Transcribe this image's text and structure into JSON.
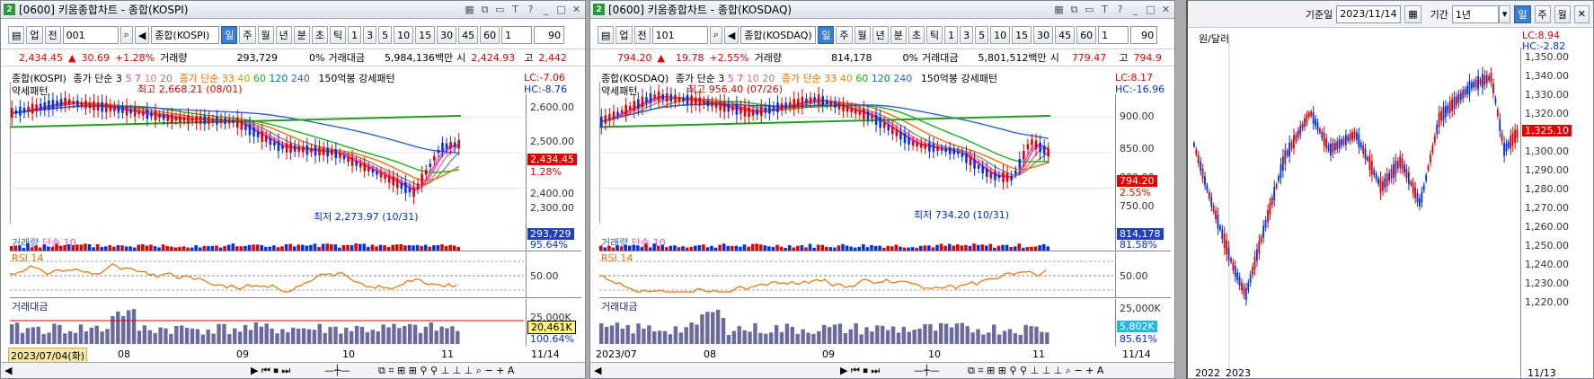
{
  "kospi": {
    "title": {
      "num": "2",
      "text": "[0600] 키움종합차트 - 종합(KOSPI)"
    },
    "toolbar": {
      "mode": "업",
      "period": "전",
      "code": "001",
      "name": "종합(KOSPI)",
      "tabs": [
        "일",
        "주",
        "월",
        "년",
        "분",
        "초",
        "틱"
      ],
      "nums": [
        "1",
        "3",
        "5",
        "10",
        "15",
        "30",
        "45",
        "60"
      ],
      "count1": "1",
      "count2": "90"
    },
    "pricebar": {
      "price": "2,434.45",
      "arrow": "▲",
      "change": "30.69",
      "pct": "+1.28%",
      "vol_label": "거래량",
      "vol": "293,729",
      "vol_pct": "0%",
      "amt_label": "거래대금",
      "amt": "5,984,136백만",
      "open_label": "시",
      "open": "2,424.93",
      "high_label": "고",
      "high": "2,442"
    },
    "legend": {
      "name": "종합(KOSPI)",
      "ma_label": "종가 단순 3",
      "ma_a": [
        "5",
        "7",
        "10",
        "20"
      ],
      "ma_b_label": "종가 단순 33",
      "ma_b": [
        "40",
        "60",
        "120",
        "240"
      ],
      "pattern": "150억봉 강세패턴",
      "pattern2": "약세패턴",
      "lc": "LC:-7.06",
      "hc": "HC:-8.76"
    },
    "ann_high": "최고 2,668.21 (08/01)",
    "ann_low": "최저 2,273.97 (10/31)",
    "price_axis": [
      "2,600.00",
      "2,500.00",
      "2,400.00",
      "2,300.00"
    ],
    "cur_tag": "2,434.45",
    "cur_pct": "1.28%",
    "vol_panel": {
      "label": "거래량",
      "ma": "단순 10",
      "tag": "293,729",
      "pct": "95.64%"
    },
    "rsi_panel": {
      "label": "RSI 14",
      "level": "50.00"
    },
    "amt_panel": {
      "label": "거래대금",
      "level": "25,000K",
      "tag": "20,461K",
      "pct": "100.64%"
    },
    "dates": {
      "start": "2023/07/04(화)",
      "m1": "08",
      "m2": "09",
      "m3": "10",
      "m4": "11",
      "end": "11/14"
    }
  },
  "kosdaq": {
    "title": {
      "num": "2",
      "text": "[0600] 키움종합차트 - 종합(KOSDAQ)"
    },
    "toolbar": {
      "mode": "업",
      "period": "전",
      "code": "101",
      "name": "종합(KOSDAQ)",
      "tabs": [
        "일",
        "주",
        "월",
        "년",
        "분",
        "초",
        "틱"
      ],
      "nums": [
        "1",
        "3",
        "5",
        "10",
        "15",
        "30",
        "45",
        "60"
      ],
      "count1": "1",
      "count2": "90"
    },
    "pricebar": {
      "price": "794.20",
      "arrow": "▲",
      "change": "19.78",
      "pct": "+2.55%",
      "vol_label": "거래량",
      "vol": "814,178",
      "vol_pct": "0%",
      "amt_label": "거래대금",
      "amt": "5,801,512백만",
      "open_label": "시",
      "open": "779.47",
      "high_label": "고",
      "high": "794.9"
    },
    "legend": {
      "name": "종합(KOSDAQ)",
      "ma_label": "종가 단순 3",
      "ma_a": [
        "5",
        "7",
        "10",
        "20"
      ],
      "ma_b_label": "종가 단순 33",
      "ma_b": [
        "40",
        "60",
        "120",
        "240"
      ],
      "pattern": "150억봉 강세패턴",
      "pattern2": "약세패턴",
      "lc": "LC:8.17",
      "hc": "HC:-16.96"
    },
    "ann_high": "최고 956.40 (07/26)",
    "ann_low": "최저 734.20 (10/31)",
    "price_axis": [
      "900.00",
      "850.00",
      "800.00",
      "750.00"
    ],
    "cur_tag": "794.20",
    "cur_pct": "2.55%",
    "vol_panel": {
      "label": "거래량",
      "ma": "단순 10",
      "tag": "814,178",
      "pct": "81.58%"
    },
    "rsi_panel": {
      "label": "RSI 14",
      "level": "50.00"
    },
    "amt_panel": {
      "label": "거래대금",
      "level": "25,000K",
      "tag": "5,802K",
      "pct": "85.61%"
    },
    "dates": {
      "start": "2023/07",
      "m1": "08",
      "m2": "09",
      "m3": "10",
      "m4": "11",
      "end": "11/14"
    }
  },
  "usd": {
    "base_label": "기준일",
    "base_date": "2023/11/14",
    "period_label": "기간",
    "period": "1년",
    "tabs": [
      "일",
      "주",
      "월"
    ],
    "legend": "원/달러",
    "lc": "LC:8.94",
    "hc": "HC:-2.82",
    "axis": [
      "1,350.00",
      "1,340.00",
      "1,330.00",
      "1,320.00",
      "1,310.00",
      "1,300.00",
      "1,290.00",
      "1,280.00",
      "1,270.00",
      "1,260.00",
      "1,250.00",
      "1,240.00",
      "1,230.00",
      "1,220.00"
    ],
    "cur_tag": "1,325.10",
    "dates": [
      "2022",
      "2023",
      "11/13"
    ]
  },
  "colors": {
    "up": "#e00000",
    "down": "#0030e0",
    "select": "#3c7ecf"
  }
}
